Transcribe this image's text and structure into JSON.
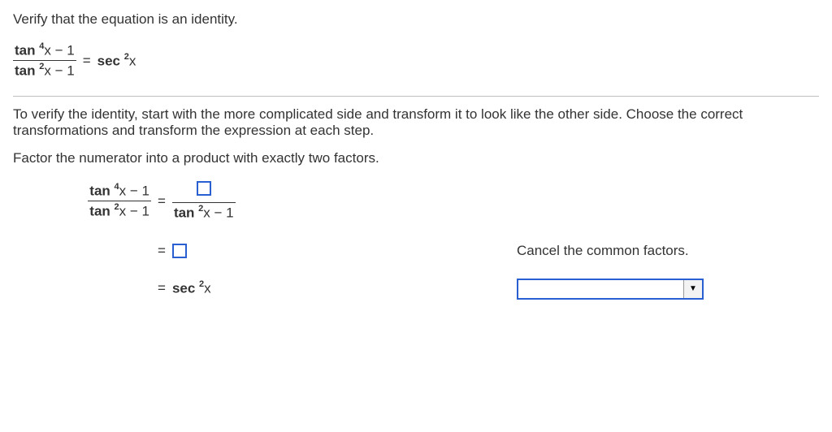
{
  "header": {
    "prompt": "Verify that the equation is an identity."
  },
  "equation": {
    "lhs_num_func": "tan",
    "lhs_num_exp": "4",
    "lhs_num_rest": "x − 1",
    "lhs_den_func": "tan",
    "lhs_den_exp": "2",
    "lhs_den_rest": "x − 1",
    "rhs_func": "sec",
    "rhs_exp": "2",
    "rhs_var": "x"
  },
  "instruction1": "To verify the identity, start with the more complicated side and transform it to look like the other side. Choose the correct transformations and transform the expression at each step.",
  "instruction2": "Factor the numerator into a product with exactly two factors.",
  "step1": {
    "lhs_num_func": "tan",
    "lhs_num_exp": "4",
    "lhs_num_rest": "x − 1",
    "lhs_den_func": "tan",
    "lhs_den_exp": "2",
    "lhs_den_rest": "x − 1",
    "rhs_den_func": "tan",
    "rhs_den_exp": "2",
    "rhs_den_rest": "x − 1"
  },
  "step2": {
    "annotation": "Cancel the common factors."
  },
  "step3": {
    "func": "sec",
    "exp": "2",
    "var": "x",
    "dropdown_selected": ""
  },
  "symbols": {
    "equals": "="
  }
}
